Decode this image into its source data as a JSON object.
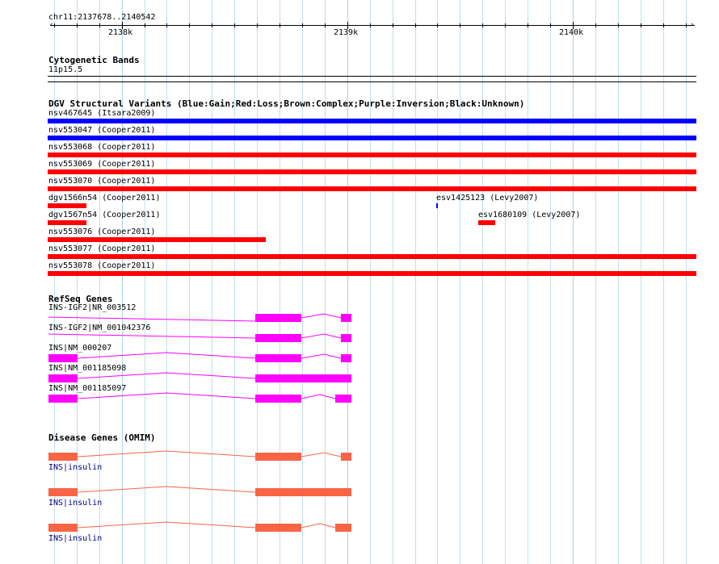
{
  "colors": {
    "grid": "#a9d4ea",
    "gain": "#0000ff",
    "loss": "#ff0000",
    "refseq": "#ff00ff",
    "omim": "#f96445",
    "omim_label": "#000080"
  },
  "ruler": {
    "position": "chr11:2137678..2140542",
    "ticks": [
      "2138k",
      "2139k",
      "2140k"
    ]
  },
  "cytobands": {
    "title": "Cytogenetic Bands",
    "band": "11p15.5"
  },
  "dgv": {
    "title": "DGV Structural Variants (Blue:Gain;Red:Loss;Brown:Complex;Purple:Inversion;Black:Unknown)",
    "variants": [
      {
        "label": "nsv467645 (Itsara2009)",
        "type": "gain"
      },
      {
        "label": "nsv553047 (Cooper2011)",
        "type": "gain"
      },
      {
        "label": "nsv553068 (Cooper2011)",
        "type": "loss"
      },
      {
        "label": "nsv553069 (Cooper2011)",
        "type": "loss"
      },
      {
        "label": "nsv553070 (Cooper2011)",
        "type": "loss"
      },
      {
        "label": "dgv1566n54 (Cooper2011)",
        "type": "loss"
      },
      {
        "label": "esv1425123 (Levy2007)",
        "type": "gain"
      },
      {
        "label": "dgv1567n54 (Cooper2011)",
        "type": "loss"
      },
      {
        "label": "esv1680109 (Levy2007)",
        "type": "loss"
      },
      {
        "label": "nsv553076 (Cooper2011)",
        "type": "loss"
      },
      {
        "label": "nsv553077 (Cooper2011)",
        "type": "loss"
      },
      {
        "label": "nsv553078 (Cooper2011)",
        "type": "loss"
      }
    ]
  },
  "refseq": {
    "title": "RefSeq Genes",
    "genes": [
      {
        "label": "INS-IGF2|NR_003512"
      },
      {
        "label": "INS-IGF2|NM_001042376"
      },
      {
        "label": "INS|NM_000207"
      },
      {
        "label": "INS|NM_001185098"
      },
      {
        "label": "INS|NM_001185097"
      }
    ]
  },
  "omim": {
    "title": "Disease Genes (OMIM)",
    "genes": [
      {
        "label": "INS|insulin"
      },
      {
        "label": "INS|insulin"
      },
      {
        "label": "INS|insulin"
      }
    ]
  }
}
